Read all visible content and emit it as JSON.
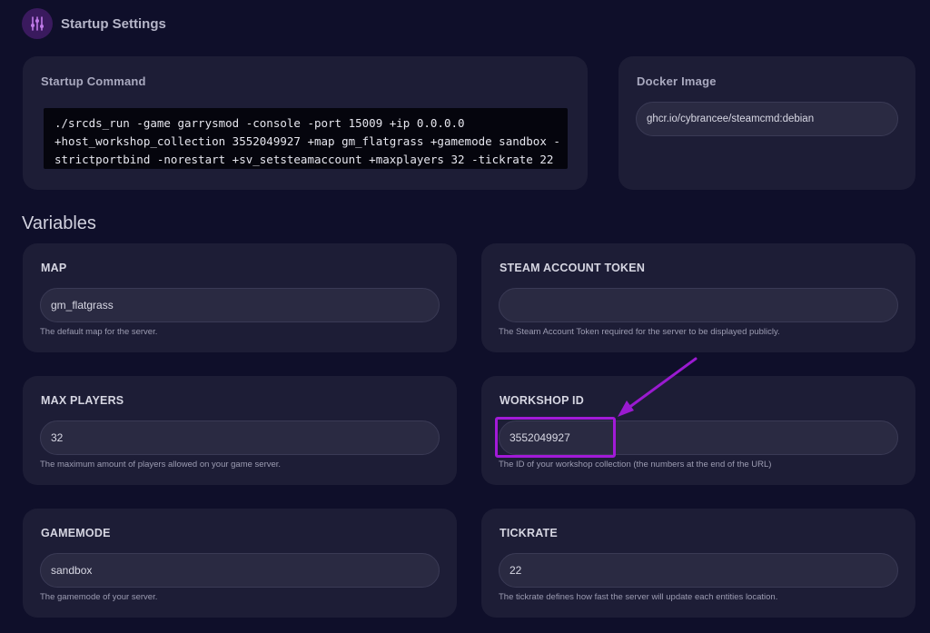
{
  "header": {
    "title": "Startup Settings",
    "icon": "sliders-icon"
  },
  "startup": {
    "label": "Startup Command",
    "lines": [
      "./srcds_run -game garrysmod -console -port 15009 +ip 0.0.0.0",
      "+host_workshop_collection 3552049927 +map gm_flatgrass +gamemode sandbox -",
      "strictportbind -norestart +sv_setsteamaccount +maxplayers 32 -tickrate 22"
    ]
  },
  "docker": {
    "label": "Docker Image",
    "value": "ghcr.io/cybrancee/steamcmd:debian"
  },
  "variables_title": "Variables",
  "variables": {
    "map": {
      "label": "MAP",
      "value": "gm_flatgrass",
      "help": "The default map for the server."
    },
    "steam": {
      "label": "STEAM ACCOUNT TOKEN",
      "value": "",
      "help": "The Steam Account Token required for the server to be displayed publicly."
    },
    "maxplayers": {
      "label": "MAX PLAYERS",
      "value": "32",
      "help": "The maximum amount of players allowed on your game server."
    },
    "workshop": {
      "label": "WORKSHOP ID",
      "value": "3552049927",
      "help": "The ID of your workshop collection (the numbers at the end of the URL)"
    },
    "gamemode": {
      "label": "GAMEMODE",
      "value": "sandbox",
      "help": "The gamemode of your server."
    },
    "tickrate": {
      "label": "TICKRATE",
      "value": "22",
      "help": "The tickrate defines how fast the server will update each entities location."
    }
  },
  "colors": {
    "background": "#0f0f2a",
    "card": "#1d1d36",
    "highlight": "#a21ad8"
  }
}
